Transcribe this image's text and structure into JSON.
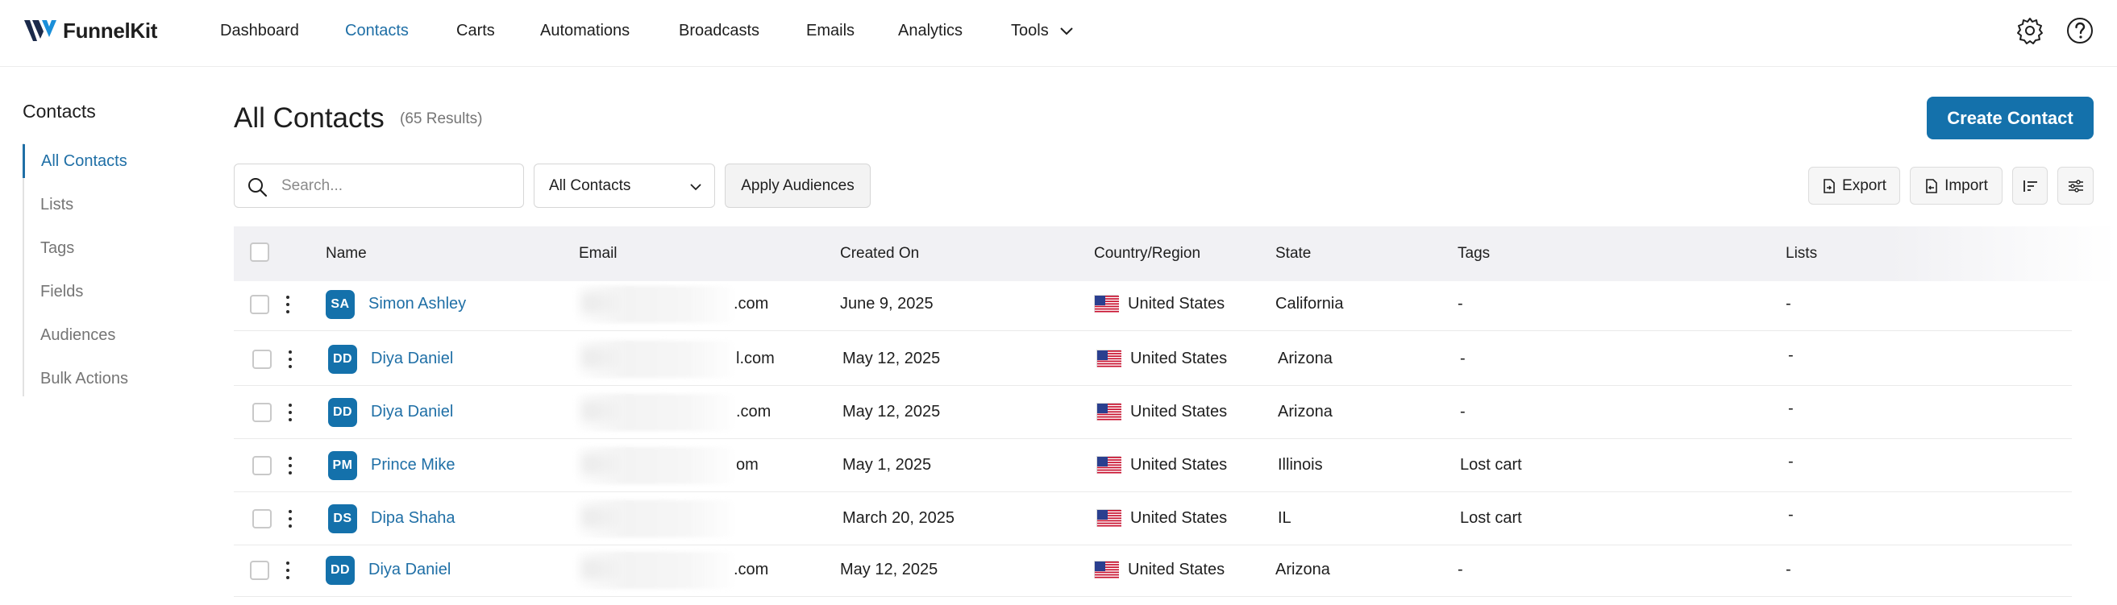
{
  "app": {
    "logo_text": "FunnelKit",
    "nav": [
      {
        "label": "Dashboard"
      },
      {
        "label": "Contacts"
      },
      {
        "label": "Carts"
      },
      {
        "label": "Automations"
      },
      {
        "label": "Broadcasts"
      },
      {
        "label": "Emails"
      },
      {
        "label": "Analytics"
      },
      {
        "label": "Tools"
      }
    ],
    "active_nav": "Contacts",
    "icons": [
      "settings-icon",
      "help-icon",
      "chevron-down-icon"
    ]
  },
  "sidebar": {
    "title": "Contacts",
    "items": [
      {
        "label": "All Contacts"
      },
      {
        "label": "Lists"
      },
      {
        "label": "Tags"
      },
      {
        "label": "Fields"
      },
      {
        "label": "Audiences"
      },
      {
        "label": "Bulk Actions"
      }
    ],
    "active": "All Contacts"
  },
  "main": {
    "title": "All Contacts",
    "results": "(65 Results)",
    "create_label": "Create Contact",
    "search_placeholder": "Search...",
    "audience_select": "All Contacts",
    "apply_label": "Apply Audiences",
    "export_label": "Export",
    "import_label": "Import"
  },
  "table": {
    "columns": [
      "Name",
      "Email",
      "Created On",
      "Country/Region",
      "State",
      "Tags",
      "Lists"
    ],
    "rows": [
      {
        "initials": "SA",
        "name": "Simon Ashley",
        "email_suffix": ".com",
        "created": "June 9, 2025",
        "country": "United States",
        "state": "California",
        "tags": "-",
        "lists": "-"
      },
      {
        "initials": "DD",
        "name": "Diya Daniel",
        "email_suffix": "l.com",
        "created": "May 12, 2025",
        "country": "United States",
        "state": "Arizona",
        "tags": "-",
        "lists": "-"
      },
      {
        "initials": "DD",
        "name": "Diya Daniel",
        "email_suffix": ".com",
        "created": "May 12, 2025",
        "country": "United States",
        "state": "Arizona",
        "tags": "-",
        "lists": "-"
      },
      {
        "initials": "PM",
        "name": "Prince Mike",
        "email_suffix": "om",
        "created": "May 1, 2025",
        "country": "United States",
        "state": "Illinois",
        "tags": "Lost cart",
        "lists": "-"
      },
      {
        "initials": "DS",
        "name": "Dipa Shaha",
        "email_suffix": "",
        "created": "March 20, 2025",
        "country": "United States",
        "state": "IL",
        "tags": "Lost cart",
        "lists": "-"
      },
      {
        "initials": "DD",
        "name": "Diya Daniel",
        "email_suffix": ".com",
        "created": "May 12, 2025",
        "country": "United States",
        "state": "Arizona",
        "tags": "-",
        "lists": "-"
      }
    ]
  },
  "colors": {
    "accent": "#1f6fa6",
    "button": "#1471ab",
    "header_bg": "#f1f1f4"
  }
}
